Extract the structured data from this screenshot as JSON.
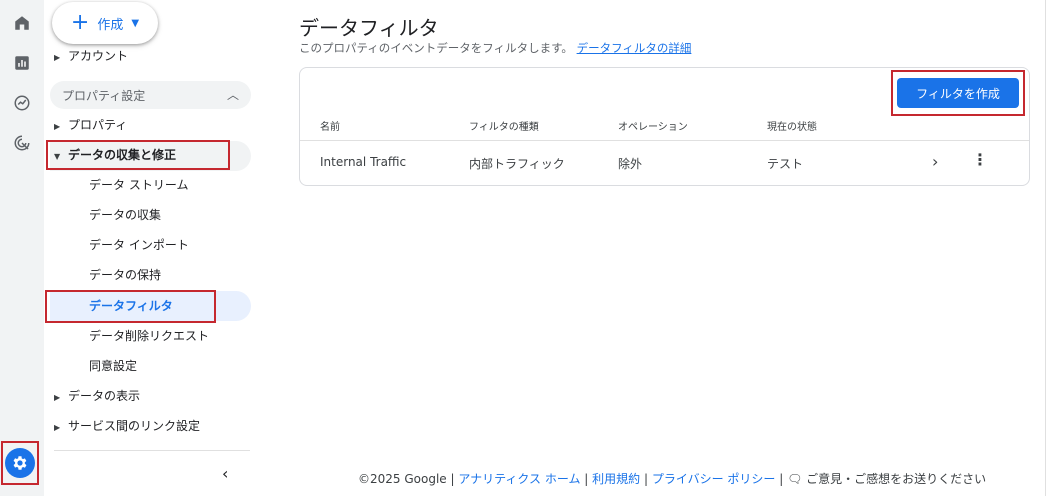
{
  "rail": {
    "icons": [
      "home-icon",
      "reports-icon",
      "explore-icon",
      "advertising-icon"
    ],
    "settings_icon": "gear-icon"
  },
  "sidebar": {
    "create_label": "作成",
    "account": "アカウント",
    "section_title": "プロパティ設定",
    "property": "プロパティ",
    "data_collection": "データの収集と修正",
    "sub_items": [
      "データ ストリーム",
      "データの収集",
      "データ インポート",
      "データの保持",
      "データフィルタ",
      "データ削除リクエスト",
      "同意設定"
    ],
    "data_display": "データの表示",
    "service_links": "サービス間のリンク設定"
  },
  "main": {
    "title": "データフィルタ",
    "subtitle": "このプロパティのイベントデータをフィルタします。",
    "subtitle_link": "データフィルタの詳細",
    "create_filter_button": "フィルタを作成",
    "columns": [
      "名前",
      "フィルタの種類",
      "オペレーション",
      "現在の状態"
    ],
    "rows": [
      {
        "name": "Internal Traffic",
        "type": "内部トラフィック",
        "operation": "除外",
        "state": "テスト"
      }
    ]
  },
  "footer": {
    "copyright": "©2025 Google",
    "analytics_home": "アナリティクス ホーム",
    "terms": "利用規約",
    "privacy": "プライバシー ポリシー",
    "feedback": "ご意見・ご感想をお送りください"
  },
  "colors": {
    "accent": "#1a73e8",
    "highlight": "#c5282f"
  }
}
